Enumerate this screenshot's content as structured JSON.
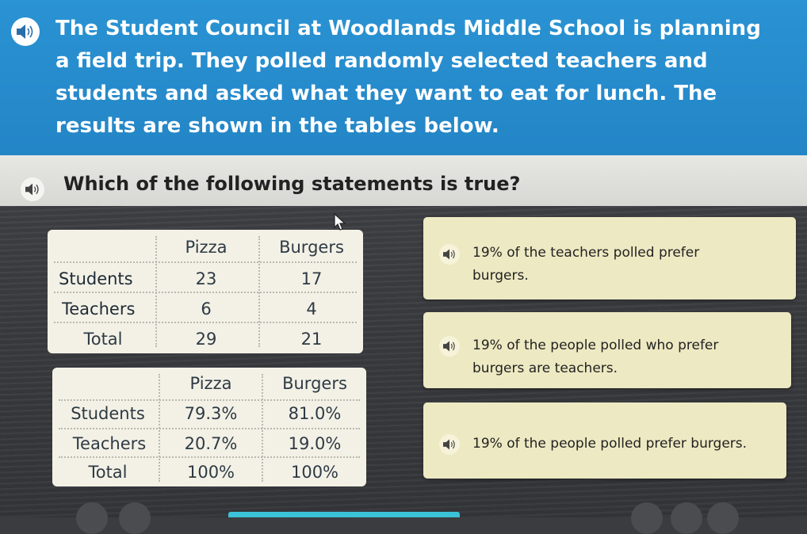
{
  "intro": {
    "text": "The Student Council at Woodlands Middle School is planning a field trip. They polled randomly selected teachers and students and asked what they want to eat for lunch. The results are shown in the tables below."
  },
  "question": {
    "text": "Which of the following statements is true?"
  },
  "table1": {
    "col_pizza": "Pizza",
    "col_burgers": "Burgers",
    "rows": [
      {
        "label": "Students",
        "pizza": "23",
        "burgers": "17"
      },
      {
        "label": "Teachers",
        "pizza": "6",
        "burgers": "4"
      },
      {
        "label": "Total",
        "pizza": "29",
        "burgers": "21"
      }
    ]
  },
  "table2": {
    "col_pizza": "Pizza",
    "col_burgers": "Burgers",
    "rows": [
      {
        "label": "Students",
        "pizza": "79.3%",
        "burgers": "81.0%"
      },
      {
        "label": "Teachers",
        "pizza": "20.7%",
        "burgers": "19.0%"
      },
      {
        "label": "Total",
        "pizza": "100%",
        "burgers": "100%"
      }
    ]
  },
  "answers": [
    {
      "text": "19% of the teachers polled prefer burgers."
    },
    {
      "text": "19% of the people polled who prefer burgers are teachers."
    },
    {
      "text": "19% of the people polled prefer burgers."
    }
  ],
  "colors": {
    "banner": "#2a93d3",
    "answer_card": "#ede9c2",
    "table_card": "#f3f1e6",
    "progress": "#3bc2d8"
  },
  "icons": {
    "speaker": "speaker-icon",
    "cursor": "mouse-cursor-icon"
  }
}
